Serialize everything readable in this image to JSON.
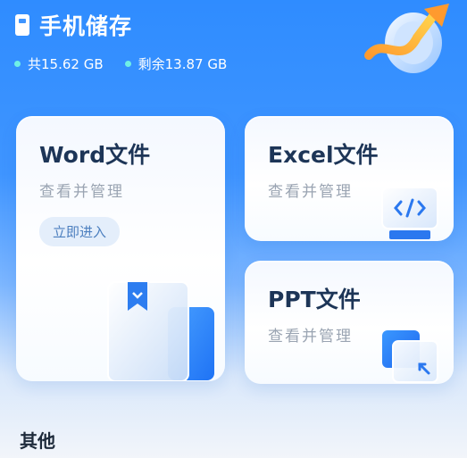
{
  "header": {
    "title": "手机储存",
    "total_label": "共15.62 GB",
    "free_label": "剩余13.87 GB"
  },
  "cards": {
    "word": {
      "title": "Word文件",
      "subtitle": "查看并管理",
      "button": "立即进入"
    },
    "excel": {
      "title": "Excel文件",
      "subtitle": "查看并管理"
    },
    "ppt": {
      "title": "PPT文件",
      "subtitle": "查看并管理"
    }
  },
  "section": {
    "other_title": "其他"
  },
  "icons": {
    "header": "phone-icon",
    "hero": "cleanup-arrow-icon",
    "word": "document-bookmark-icon",
    "excel": "code-monitor-icon",
    "ppt": "arrow-expand-icon"
  },
  "colors": {
    "accent": "#2f8cff",
    "dot": "#6ff0e6",
    "title": "#1d3557",
    "muted": "#9aa4b2"
  }
}
